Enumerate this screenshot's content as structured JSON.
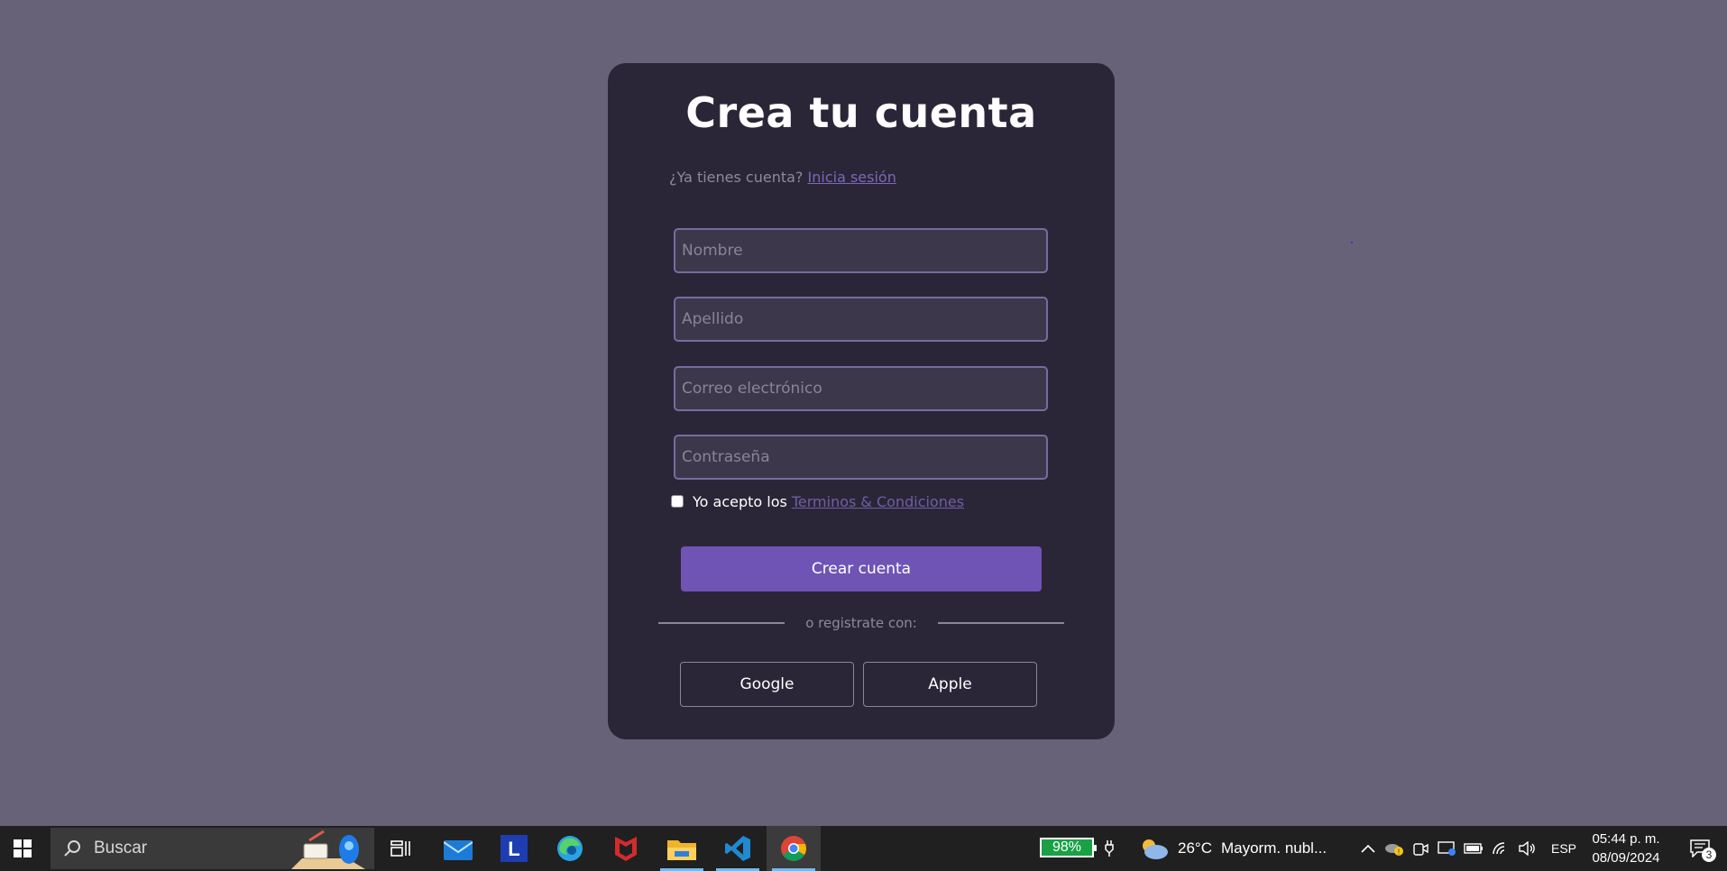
{
  "form": {
    "title": "Crea tu cuenta",
    "login_prompt": "¿Ya tienes cuenta?",
    "login_link": "Inicia sesión",
    "fields": {
      "first_name": {
        "placeholder": "Nombre",
        "value": ""
      },
      "last_name": {
        "placeholder": "Apellido",
        "value": ""
      },
      "email": {
        "placeholder": "Correo electrónico",
        "value": ""
      },
      "password": {
        "placeholder": "Contraseña",
        "value": ""
      }
    },
    "terms_prefix": "Yo acepto los",
    "terms_link": "Terminos & Condiciones",
    "terms_checked": false,
    "submit_label": "Crear cuenta",
    "divider_text": "o registrate con:",
    "google_label": "Google",
    "apple_label": "Apple"
  },
  "colors": {
    "page_background": "#686279",
    "card_background": "#2b2637",
    "accent": "#6f54b6",
    "input_border": "#766da0"
  },
  "taskbar": {
    "search_label": "Buscar",
    "apps": [
      "mail-icon",
      "l-app-icon",
      "edge-icon",
      "mcafee-icon",
      "file-explorer-icon",
      "vscode-icon",
      "chrome-icon"
    ],
    "battery": "98%",
    "weather_temp": "26°C",
    "weather_desc": "Mayorm. nubl...",
    "language": "ESP",
    "time": "05:44 p. m.",
    "date": "08/09/2024",
    "notification_count": "3"
  }
}
